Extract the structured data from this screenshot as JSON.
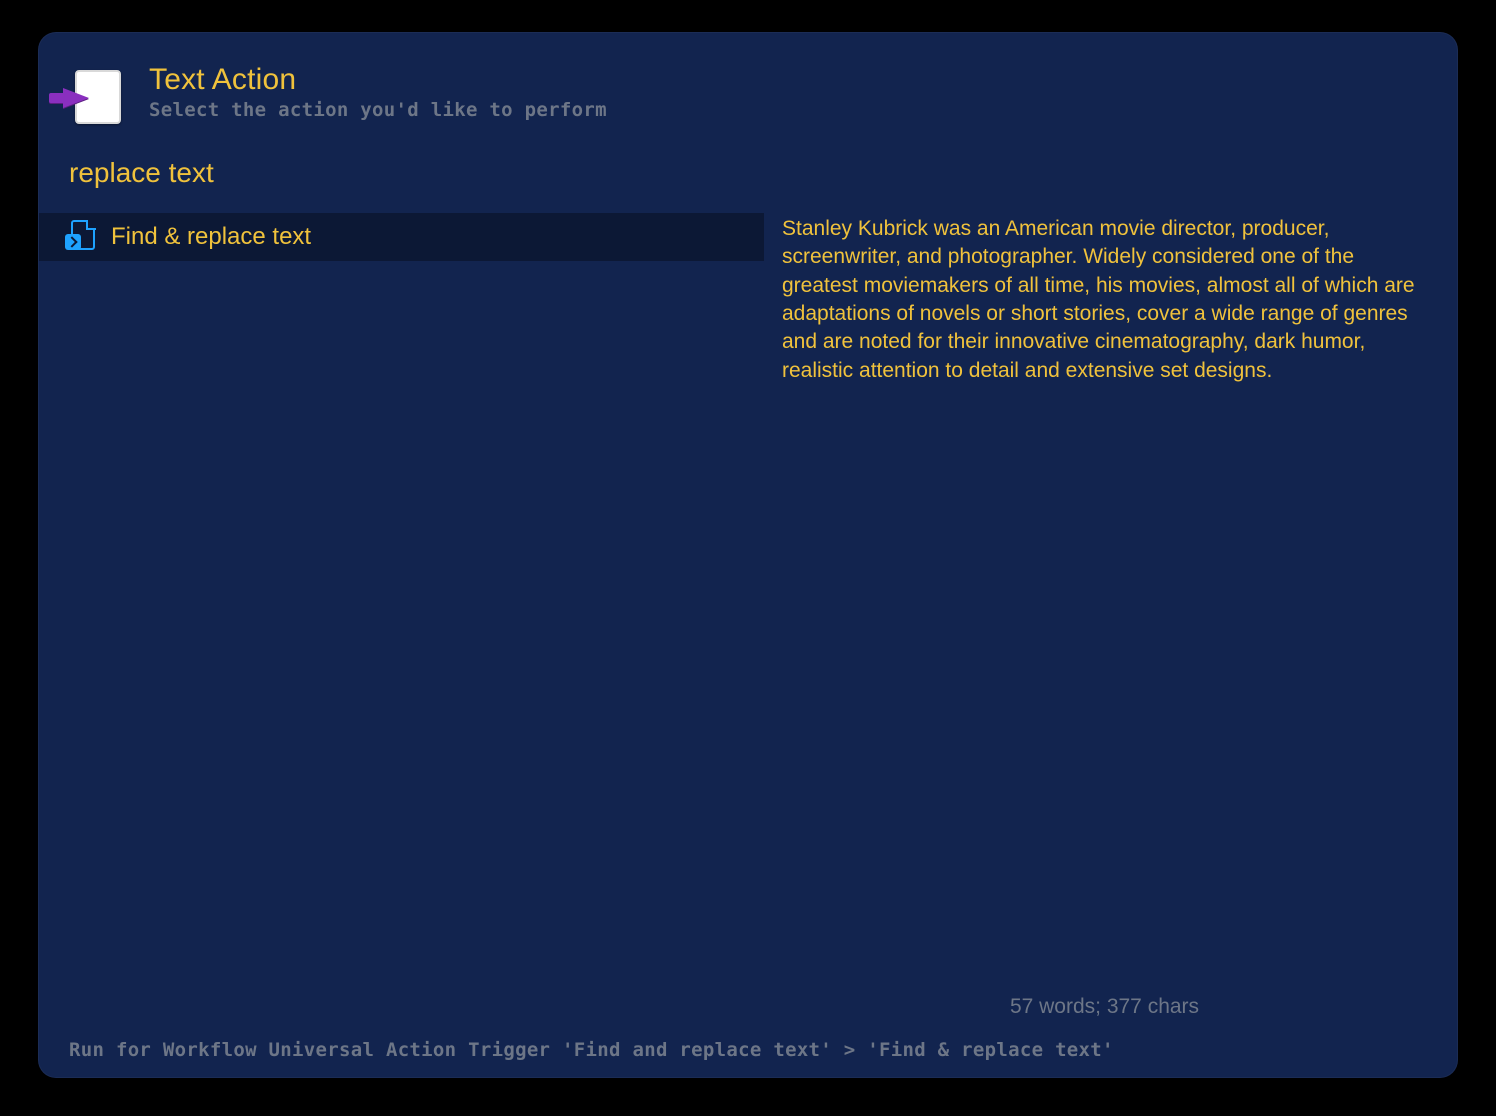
{
  "header": {
    "title": "Text Action",
    "subtitle": "Select the action you'd like to perform"
  },
  "query": "replace text",
  "results": [
    {
      "label": "Find & replace text"
    }
  ],
  "preview": {
    "text": "Stanley Kubrick was an American movie director, producer, screenwriter, and photographer. Widely considered one of the greatest moviemakers of all time, his movies, almost all of which are adaptations of novels or short stories, cover a wide range of genres and are noted for their innovative cinematography, dark humor, realistic attention to detail and extensive set designs.",
    "stats": "57 words; 377 chars"
  },
  "footer": {
    "breadcrumb": "Run for Workflow Universal Action Trigger 'Find and replace text' > 'Find & replace text'"
  }
}
